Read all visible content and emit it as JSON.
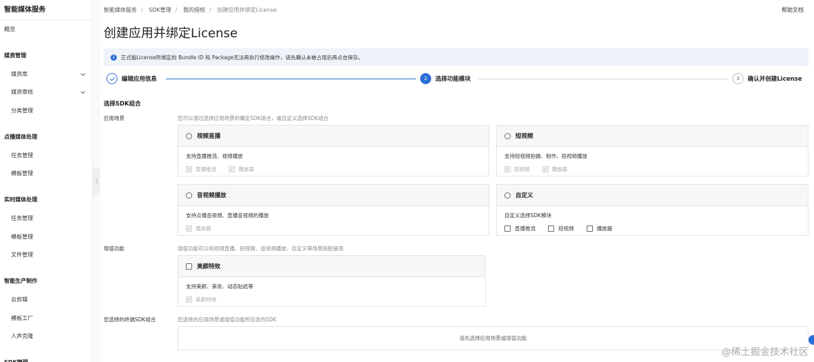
{
  "sidebar": {
    "title": "智能媒体服务",
    "overview": "概览",
    "groups": [
      {
        "label": "媒资管理",
        "items": [
          {
            "label": "媒资库",
            "expandable": true
          },
          {
            "label": "媒资审核",
            "expandable": true
          },
          {
            "label": "分类管理",
            "expandable": false
          }
        ]
      },
      {
        "label": "点播媒体处理",
        "items": [
          {
            "label": "任务管理"
          },
          {
            "label": "模板管理"
          }
        ]
      },
      {
        "label": "实时媒体处理",
        "items": [
          {
            "label": "任务管理"
          },
          {
            "label": "模板管理"
          },
          {
            "label": "文件管理"
          }
        ]
      },
      {
        "label": "智能生产制作",
        "items": [
          {
            "label": "云剪辑"
          },
          {
            "label": "模板工厂"
          },
          {
            "label": "人声克隆"
          }
        ]
      },
      {
        "label": "SDK管理",
        "items": []
      }
    ]
  },
  "breadcrumb": [
    "智能媒体服务",
    "SDK管理",
    "我的授权",
    "创建应用并绑定License"
  ],
  "help_link": "帮助文档",
  "page_title": "创建应用并绑定License",
  "alert": "正式版License所绑定的 Bundle ID 和 Package无法再执行修改操作，请先确认未被占用后再点击保存。",
  "steps": [
    {
      "index": "1",
      "label": "编辑应用信息",
      "state": "done"
    },
    {
      "index": "2",
      "label": "选择功能模块",
      "state": "active"
    },
    {
      "index": "3",
      "label": "确认并创建License",
      "state": "pending"
    }
  ],
  "section_title": "选择SDK组合",
  "scenario": {
    "label": "应用场景",
    "desc": "您可以通过选择应用场景的确定SDK组合，或自定义选择SDK组合",
    "cards": [
      {
        "title": "视频直播",
        "desc": "支持直播推流、视频播放",
        "options": [
          "直播推流",
          "播放器"
        ]
      },
      {
        "title": "短视频",
        "desc": "支持短视频拍摄、制作、短视频播放",
        "options": [
          "短视频",
          "播放器"
        ]
      },
      {
        "title": "音视频播放",
        "desc": "支持点播音视频、直播音视频的播放",
        "options": [
          "播放器"
        ]
      },
      {
        "title": "自定义",
        "desc": "自定义选择SDK模块",
        "options": [
          "直播推流",
          "短视频",
          "播放器"
        ]
      }
    ]
  },
  "value_added": {
    "label": "增值功能",
    "desc": "增值功能可以和视频直播、短视频、音视频播放、自定义等场景搭配使用",
    "card": {
      "title": "美颜特效",
      "desc": "支持美颜、美妆、动态贴纸等",
      "options": [
        "美颜特效"
      ]
    }
  },
  "result": {
    "label": "您选择的终端SDK组合",
    "desc": "您选择的应用场景或增值功能所包含的SDK",
    "placeholder": "请先选择应用场景或增值功能"
  },
  "watermark": "@稀土掘金技术社区",
  "colors": {
    "accent": "#2b6fd6",
    "alert_bg": "#eef3f9"
  }
}
